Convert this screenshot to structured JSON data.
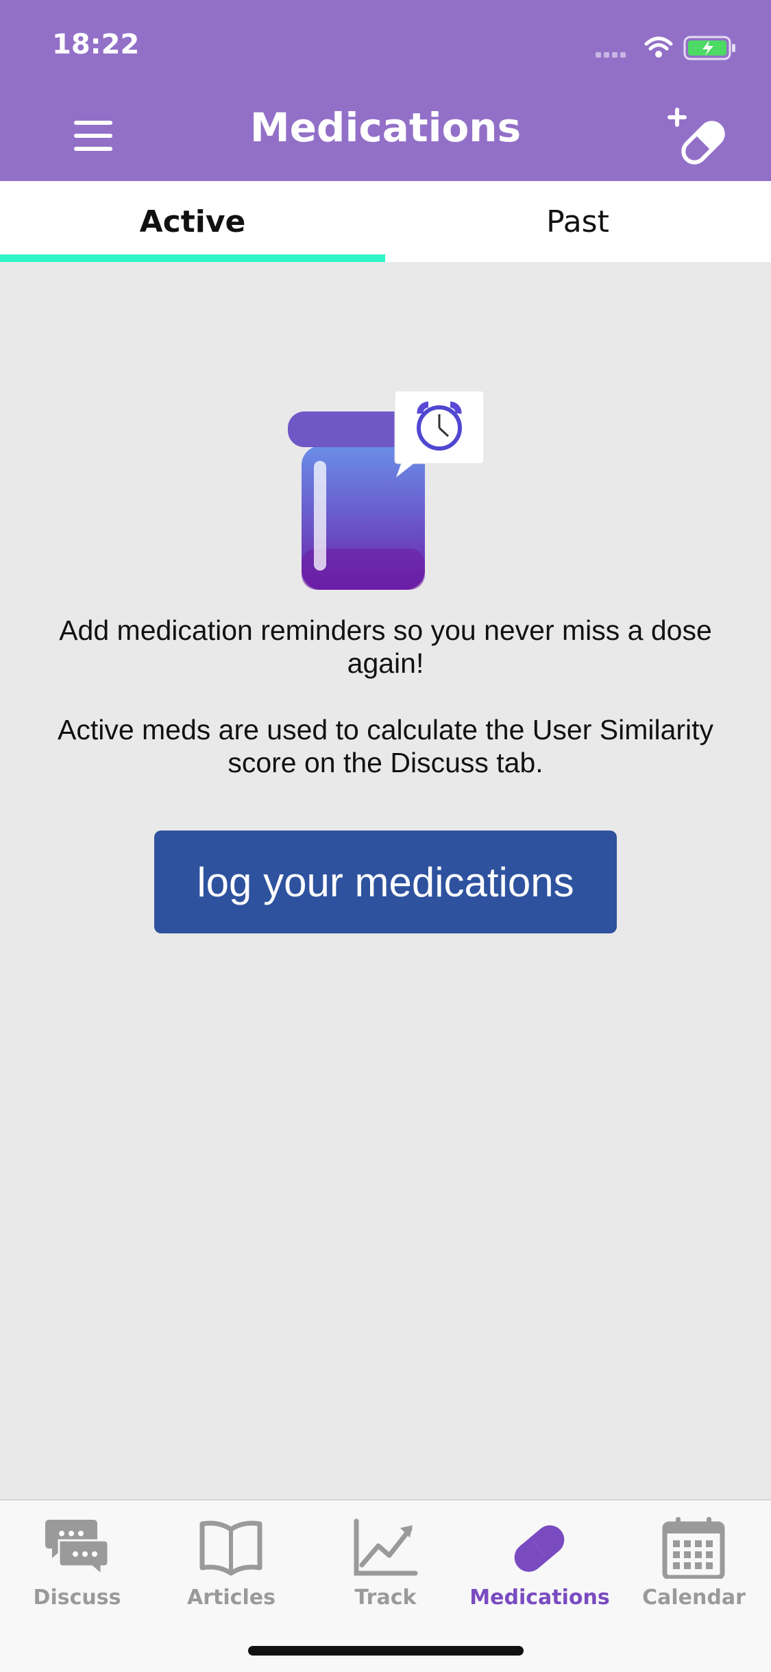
{
  "status": {
    "time": "18:22"
  },
  "header": {
    "title": "Medications"
  },
  "tabs": [
    {
      "label": "Active",
      "selected": true
    },
    {
      "label": "Past",
      "selected": false
    }
  ],
  "empty_state": {
    "message_1": "Add medication reminders so you never miss a dose again!",
    "message_2": "Active meds are used to calculate the User Similarity score on the Discuss tab.",
    "cta_label": "log your medications"
  },
  "tabbar": {
    "items": [
      {
        "label": "Discuss",
        "icon": "chat-bubbles-icon"
      },
      {
        "label": "Articles",
        "icon": "book-icon"
      },
      {
        "label": "Track",
        "icon": "chart-icon"
      },
      {
        "label": "Medications",
        "icon": "pill-icon",
        "active": true
      },
      {
        "label": "Calendar",
        "icon": "calendar-icon"
      }
    ]
  },
  "colors": {
    "header": "#9370c8",
    "tab_indicator": "#2ff5c7",
    "cta": "#2e529e",
    "active_tab_icon": "#7a4bc0"
  }
}
